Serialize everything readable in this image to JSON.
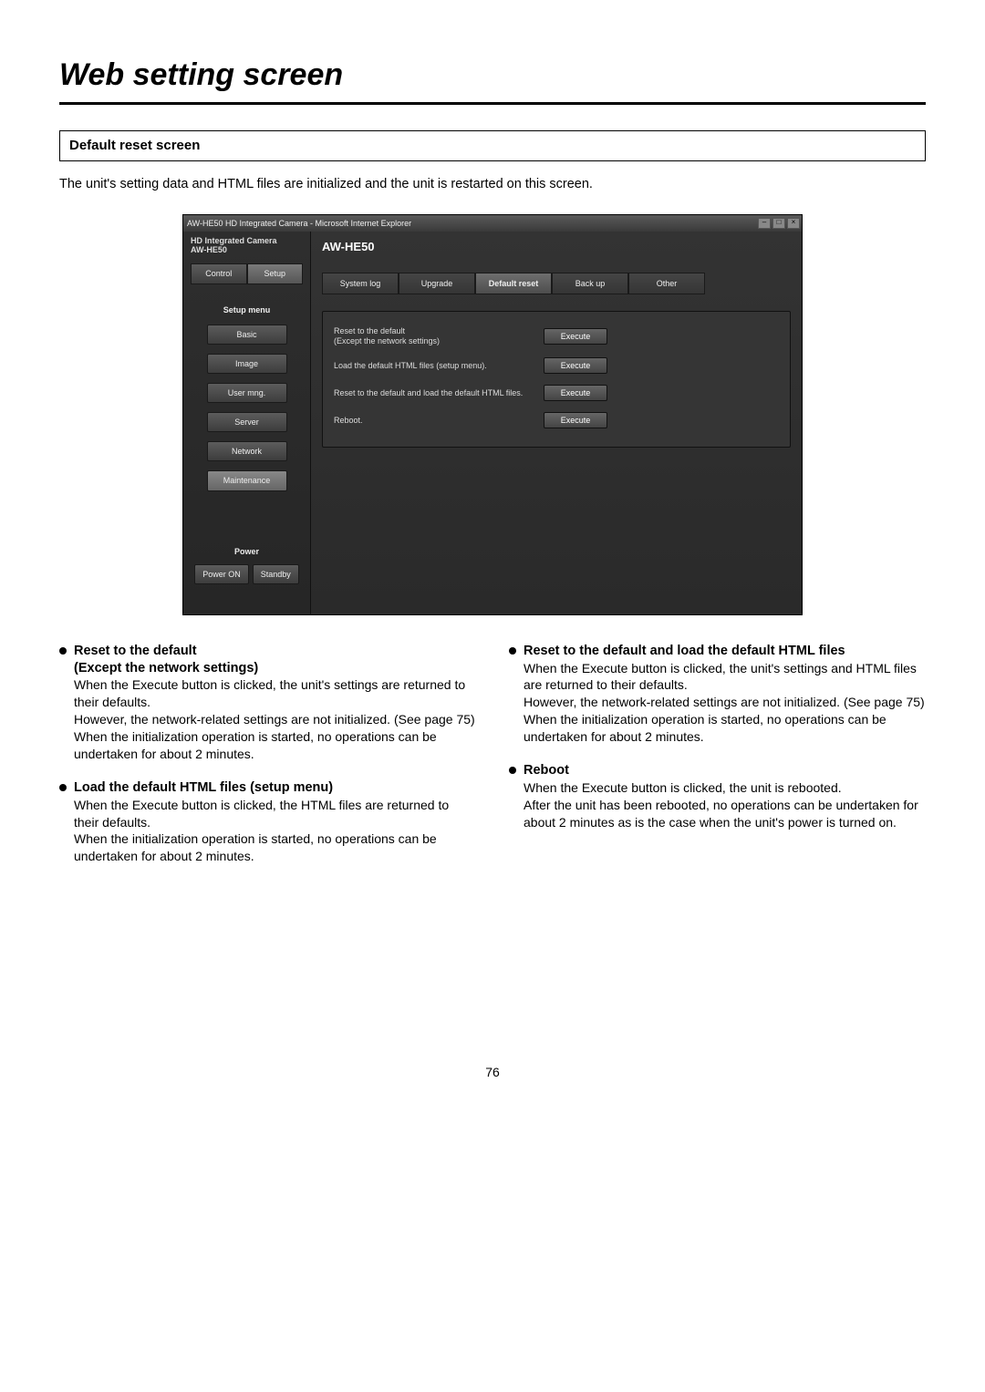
{
  "page": {
    "title": "Web setting screen",
    "section_header": "Default reset screen",
    "intro": "The unit's setting data and HTML files are initialized and the unit is restarted on this screen.",
    "page_number": "76"
  },
  "shot": {
    "window_title": "AW-HE50 HD Integrated Camera - Microsoft Internet Explorer",
    "sidebar_title_line1": "HD Integrated Camera",
    "sidebar_title_line2": "AW-HE50",
    "app_title": "AW-HE50",
    "header_tabs": {
      "control": "Control",
      "setup": "Setup"
    },
    "setup_menu_label": "Setup menu",
    "menu_items": [
      "Basic",
      "Image",
      "User mng.",
      "Server",
      "Network",
      "Maintenance"
    ],
    "power_label": "Power",
    "power_on": "Power ON",
    "standby": "Standby",
    "tabs": [
      "System log",
      "Upgrade",
      "Default reset",
      "Back up",
      "Other"
    ],
    "active_tab_index": 2,
    "rows": [
      {
        "label": "Reset to the default\n(Except the network settings)",
        "button": "Execute"
      },
      {
        "label": "Load the default HTML files (setup menu).",
        "button": "Execute"
      },
      {
        "label": "Reset to the default and load the default HTML files.",
        "button": "Execute"
      },
      {
        "label": "Reboot.",
        "button": "Execute"
      }
    ]
  },
  "desc": {
    "left": [
      {
        "title": "Reset to the default\n(Except the network settings)",
        "body": "When the Execute button is clicked, the unit's settings are returned to their defaults.\nHowever, the network-related settings are not initialized. (See page 75)\nWhen the initialization operation is started, no operations can be undertaken for about 2 minutes."
      },
      {
        "title": "Load the default HTML files (setup menu)",
        "body": "When the Execute button is clicked, the HTML files are returned to their defaults.\nWhen the initialization operation is started, no operations can be undertaken for about 2 minutes."
      }
    ],
    "right": [
      {
        "title": "Reset to the default and load the default HTML files",
        "body": "When the Execute button is clicked, the unit's settings and HTML files are returned to their defaults.\nHowever, the network-related settings are not initialized. (See page 75)\nWhen the initialization operation is started, no operations can be undertaken for about 2 minutes."
      },
      {
        "title": "Reboot",
        "body": "When the Execute button is clicked, the unit is rebooted.\nAfter the unit has been rebooted, no operations can be undertaken for about 2 minutes as is the case when the unit's power is turned on."
      }
    ]
  }
}
